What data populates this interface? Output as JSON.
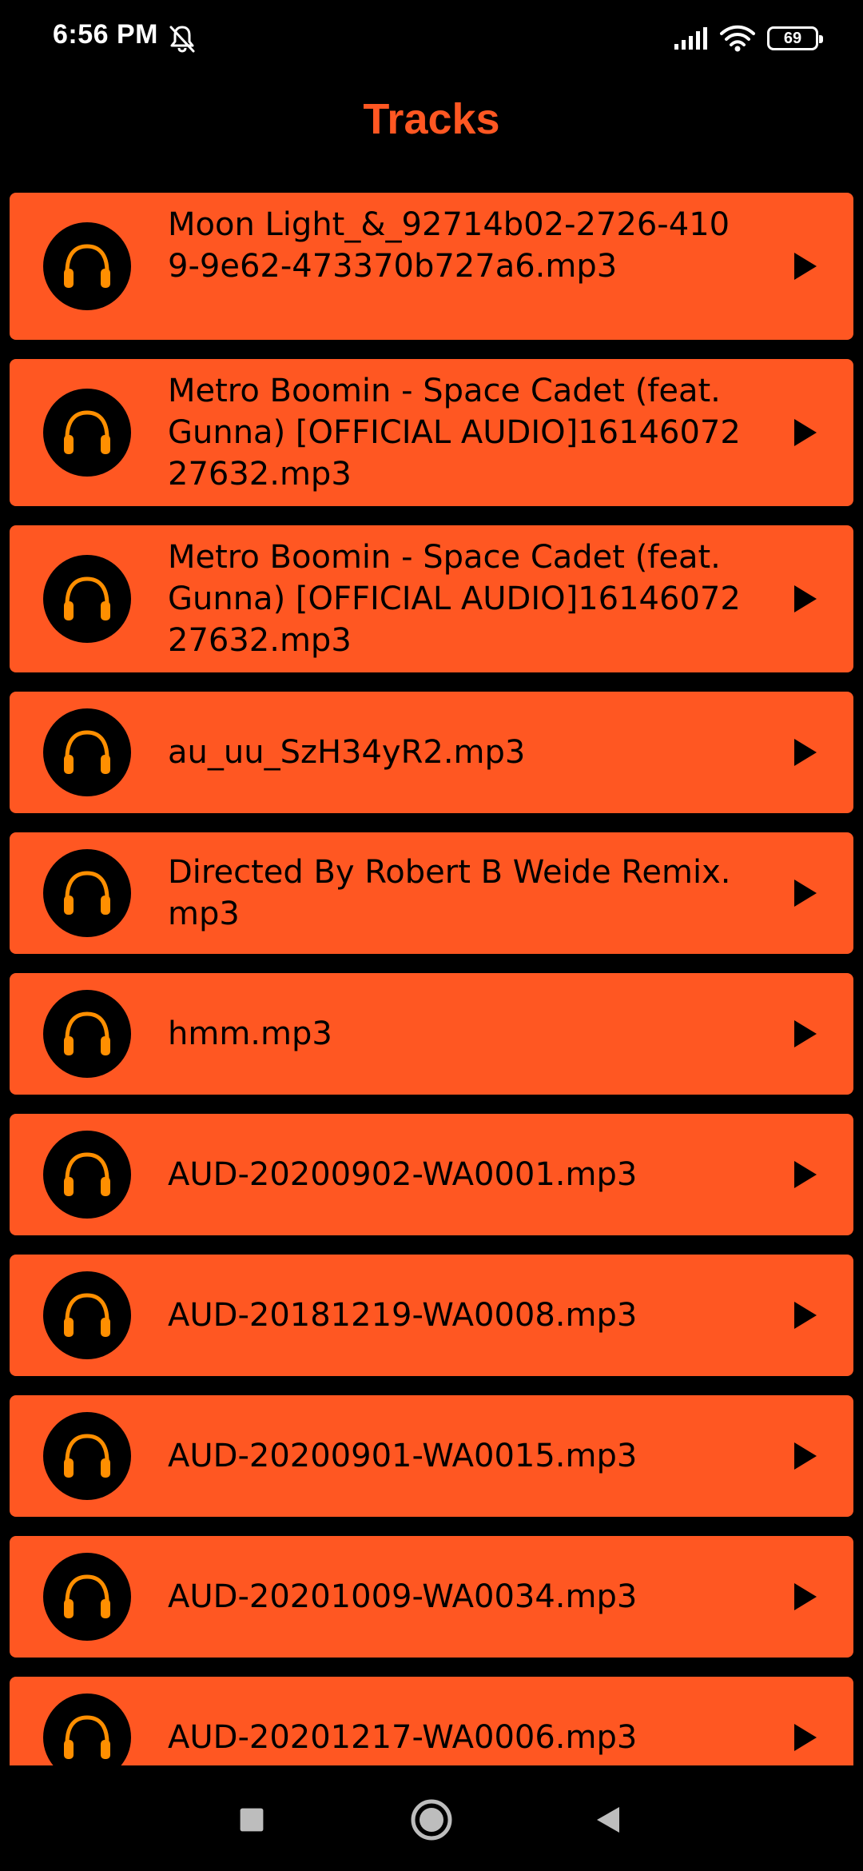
{
  "status_bar": {
    "time": "6:56 PM",
    "battery": "69",
    "icons": [
      "notifications-off-icon",
      "signal-icon",
      "wifi-icon",
      "battery-icon"
    ]
  },
  "header": {
    "title": "Tracks"
  },
  "colors": {
    "accent": "#FF5722",
    "background": "#000000",
    "headphones": "#FF8F00",
    "text_on_accent": "#000000"
  },
  "tracks": [
    {
      "title": "Moon Light_&_92714b02-2726-4109-9e62-473370b727a6.mp3",
      "icon": "headphones-icon",
      "action_icon": "play-icon"
    },
    {
      "title": "Metro Boomin - Space Cadet (feat. Gunna) [OFFICIAL AUDIO]1614607227632.mp3",
      "icon": "headphones-icon",
      "action_icon": "play-icon"
    },
    {
      "title": "Metro Boomin - Space Cadet (feat. Gunna) [OFFICIAL AUDIO]1614607227632.mp3",
      "icon": "headphones-icon",
      "action_icon": "play-icon"
    },
    {
      "title": "au_uu_SzH34yR2.mp3",
      "icon": "headphones-icon",
      "action_icon": "play-icon"
    },
    {
      "title": "Directed By Robert B Weide Remix.mp3",
      "icon": "headphones-icon",
      "action_icon": "play-icon"
    },
    {
      "title": "hmm.mp3",
      "icon": "headphones-icon",
      "action_icon": "play-icon"
    },
    {
      "title": "AUD-20200902-WA0001.mp3",
      "icon": "headphones-icon",
      "action_icon": "play-icon"
    },
    {
      "title": "AUD-20181219-WA0008.mp3",
      "icon": "headphones-icon",
      "action_icon": "play-icon"
    },
    {
      "title": "AUD-20200901-WA0015.mp3",
      "icon": "headphones-icon",
      "action_icon": "play-icon"
    },
    {
      "title": "AUD-20201009-WA0034.mp3",
      "icon": "headphones-icon",
      "action_icon": "play-icon"
    },
    {
      "title": "AUD-20201217-WA0006.mp3",
      "icon": "headphones-icon",
      "action_icon": "play-icon"
    }
  ],
  "nav_bar": {
    "buttons": [
      "recents-icon",
      "home-icon",
      "back-icon"
    ]
  }
}
